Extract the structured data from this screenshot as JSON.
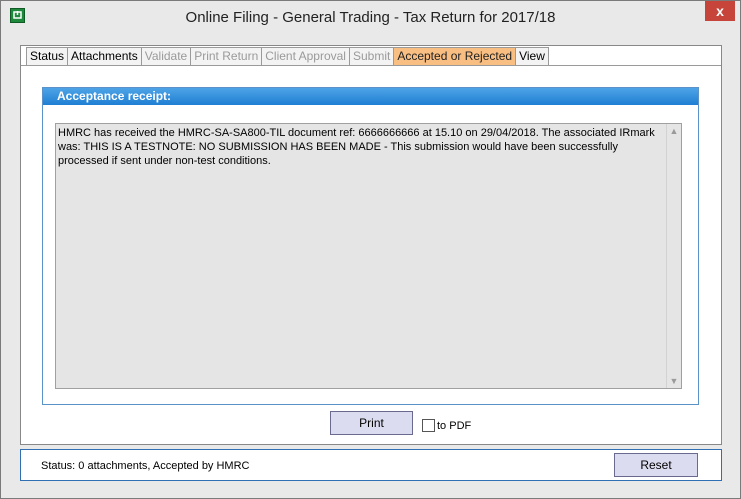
{
  "window": {
    "title": "Online Filing - General Trading - Tax Return for 2017/18",
    "close_glyph": "x"
  },
  "tabs": [
    {
      "label": "Status",
      "state": "normal"
    },
    {
      "label": "Attachments",
      "state": "normal"
    },
    {
      "label": "Validate",
      "state": "disabled"
    },
    {
      "label": "Print Return",
      "state": "disabled"
    },
    {
      "label": "Client Approval",
      "state": "disabled"
    },
    {
      "label": "Submit",
      "state": "disabled"
    },
    {
      "label": "Accepted or Rejected",
      "state": "active"
    },
    {
      "label": "View",
      "state": "normal"
    }
  ],
  "receipt": {
    "header": "Acceptance receipt:",
    "text": "HMRC has received the HMRC-SA-SA800-TIL document ref: 6666666666 at 15.10 on 29/04/2018. The associated IRmark was: THIS IS A TESTNOTE: NO SUBMISSION HAS BEEN MADE - This submission would have been successfully processed if sent under non-test conditions."
  },
  "actions": {
    "print_label": "Print",
    "to_pdf_label": "to PDF",
    "to_pdf_checked": false
  },
  "status": {
    "text": "Status: 0 attachments, Accepted by HMRC",
    "reset_label": "Reset"
  },
  "icons": {
    "app": "app-icon",
    "scroll_up": "chevron-up-icon",
    "scroll_down": "chevron-down-icon"
  },
  "colors": {
    "active_tab": "#f9be82",
    "header_blue": "#1f7fd3",
    "close_red": "#c7443a"
  }
}
